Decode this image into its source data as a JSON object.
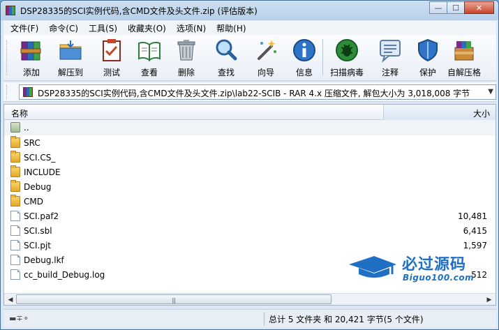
{
  "window": {
    "title": "DSP28335的SCI实例代码,含CMD文件及头文件.zip (评估版本)"
  },
  "menu": [
    {
      "label": "文件(F)"
    },
    {
      "label": "命令(C)"
    },
    {
      "label": "工具(S)"
    },
    {
      "label": "收藏夹(O)"
    },
    {
      "label": "选项(N)"
    },
    {
      "label": "帮助(H)"
    }
  ],
  "toolbar": [
    {
      "label": "添加",
      "icon": "books-add-icon"
    },
    {
      "label": "解压到",
      "icon": "folder-extract-icon"
    },
    {
      "label": "测试",
      "icon": "clipboard-check-icon"
    },
    {
      "label": "查看",
      "icon": "open-book-icon"
    },
    {
      "label": "删除",
      "icon": "trash-icon"
    },
    {
      "label": "查找",
      "icon": "magnifier-icon"
    },
    {
      "label": "向导",
      "icon": "wizard-wand-icon"
    },
    {
      "label": "信息",
      "icon": "info-icon"
    },
    {
      "label": "扫描病毒",
      "icon": "virus-scan-icon"
    },
    {
      "label": "注释",
      "icon": "comment-icon"
    },
    {
      "label": "保护",
      "icon": "shield-icon"
    },
    {
      "label": "自解压格",
      "icon": "sfx-archive-icon"
    }
  ],
  "address": {
    "text": "DSP28335的SCI实例代码,含CMD文件及头文件.zip\\lab22-SCIB - RAR 4.x 压缩文件, 解包大小为 3,018,008 字节"
  },
  "columns": {
    "name": "名称",
    "size": "大小"
  },
  "files": [
    {
      "name": "..",
      "size": "",
      "type": "up"
    },
    {
      "name": "SRC",
      "size": "",
      "type": "folder"
    },
    {
      "name": "SCI.CS_",
      "size": "",
      "type": "folder"
    },
    {
      "name": "INCLUDE",
      "size": "",
      "type": "folder"
    },
    {
      "name": "Debug",
      "size": "",
      "type": "folder"
    },
    {
      "name": "CMD",
      "size": "",
      "type": "folder"
    },
    {
      "name": "SCI.paf2",
      "size": "10,481",
      "type": "file"
    },
    {
      "name": "SCI.sbl",
      "size": "6,415",
      "type": "file"
    },
    {
      "name": "SCI.pjt",
      "size": "1,597",
      "type": "file"
    },
    {
      "name": "Debug.lkf",
      "size": "",
      "type": "file"
    },
    {
      "name": "cc_build_Debug.log",
      "size": "512",
      "type": "file"
    }
  ],
  "status": {
    "text": "总计 5 文件夹 和 20,421 字节(5 个文件)"
  },
  "watermark": {
    "main": "必过源码",
    "sub": "Biguo100.com"
  },
  "colors": {
    "accent": "#1f6fc4",
    "titlebar": "#b7cfe9"
  }
}
